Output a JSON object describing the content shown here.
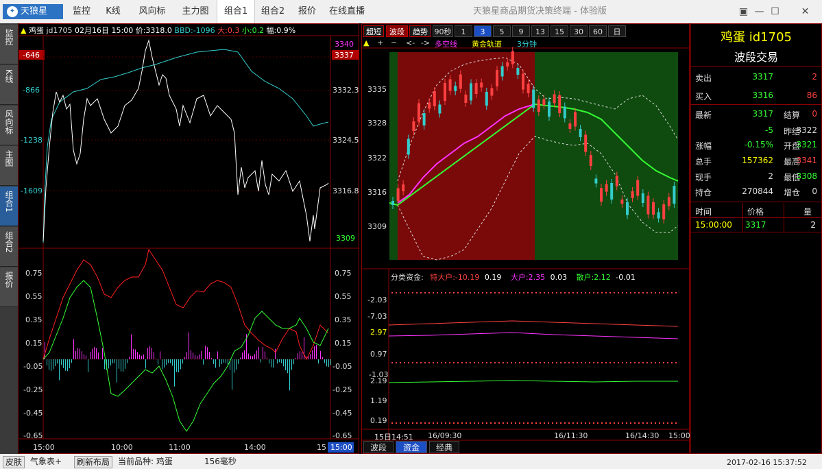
{
  "app": {
    "logo": "天狼星",
    "title": "天狼星商品期货决策终端 - 体验版",
    "menu": [
      "监控",
      "K线",
      "风向标",
      "主力图",
      "组合1",
      "组合2",
      "报价",
      "在线直播"
    ],
    "active_menu": "组合1",
    "window_buttons": [
      "▣",
      "—",
      "☐",
      "✕"
    ]
  },
  "side_tabs": [
    "监控",
    "K线",
    "风向标",
    "主图",
    "组合1",
    "组合2",
    "报价"
  ],
  "left_panel": {
    "info": {
      "name": "鸡蛋",
      "code": "jd1705",
      "date": "02月16日",
      "time": "15:00",
      "price": "价:3318.0",
      "bbd": "BBD:-1096",
      "big": "大:0.3",
      "small": "小:0.2",
      "amp": "幅:0.9%"
    },
    "left_axis": [
      "-646",
      "-866",
      "-1238",
      "-1609"
    ],
    "right_axis": [
      "3340",
      "3337",
      "3332.3",
      "3324.5",
      "3316.8",
      "3309"
    ],
    "osc_axis": [
      "0.75",
      "0.55",
      "0.35",
      "0.15",
      "-0.05",
      "-0.25",
      "-0.45",
      "-0.65"
    ],
    "time_axis": [
      "15:00",
      "10:00",
      "11:00",
      "14:00",
      "15",
      "15:00"
    ]
  },
  "middle_panel": {
    "periods": [
      "超短",
      "波段",
      "趋势",
      "90秒",
      "1",
      "3",
      "5",
      "9",
      "13",
      "15",
      "30",
      "60",
      "日"
    ],
    "selected_period": "3",
    "tools": [
      "▲",
      "+",
      "−",
      "<-",
      "->"
    ],
    "legend": [
      "多空线",
      "黄金轨道",
      "3分钟"
    ],
    "y_axis": [
      "3335",
      "3328",
      "3322",
      "3316",
      "3309"
    ],
    "fund_header": {
      "label": "分类资金:",
      "super_large": "特大户:-10.19",
      "super_large_2": "0.19",
      "large": "大户:2.35",
      "large_2": "0.03",
      "retail": "散户:2.12",
      "retail_2": "-0.01"
    },
    "fund_axis": [
      "-2.03",
      "-7.03",
      "2.97",
      "0.97",
      "-1.03",
      "2.19",
      "1.19",
      "0.19"
    ],
    "time_axis": [
      "15日14:51",
      "16/09:30",
      "16/11:30",
      "16/14:30",
      "15:00"
    ],
    "bottom_tabs": [
      "波段",
      "资金",
      "经典"
    ],
    "active_tab": "资金"
  },
  "right_panel": {
    "title": "鸡蛋 id1705",
    "subtitle": "波段交易",
    "sell": {
      "label": "卖出",
      "price": "3317",
      "vol": "2"
    },
    "buy": {
      "label": "买入",
      "price": "3316",
      "vol": "86"
    },
    "rows": [
      {
        "l1": "最新",
        "v1": "3317",
        "l2": "结算",
        "v2": "0"
      },
      {
        "l1": "",
        "v1": "-5",
        "l2": "昨结",
        "v2": "3322"
      },
      {
        "l1": "涨幅",
        "v1": "-0.15%",
        "l2": "开盘",
        "v2": "3321"
      },
      {
        "l1": "总手",
        "v1": "157362",
        "l2": "最高",
        "v2": "3341"
      },
      {
        "l1": "现手",
        "v1": "2",
        "l2": "最低",
        "v2": "3308"
      },
      {
        "l1": "持仓",
        "v1": "270844",
        "l2": "增仓",
        "v2": "0"
      }
    ],
    "trade_header": [
      "时间",
      "价格",
      "量"
    ],
    "trades": [
      {
        "time": "15:00:00",
        "price": "3317",
        "vol": "2"
      }
    ]
  },
  "status": {
    "skin": "皮肤",
    "weather": "气象表+",
    "refresh": "刷新布局",
    "current": "当前品种: 鸡蛋",
    "latency": "156毫秒",
    "datetime": "2017-02-16 15:37:52"
  },
  "colors": {
    "red": "#ff2020",
    "cyan": "#33cccc",
    "magenta": "#ff33ff",
    "green": "#33ff33",
    "yellow": "#ffff00"
  }
}
